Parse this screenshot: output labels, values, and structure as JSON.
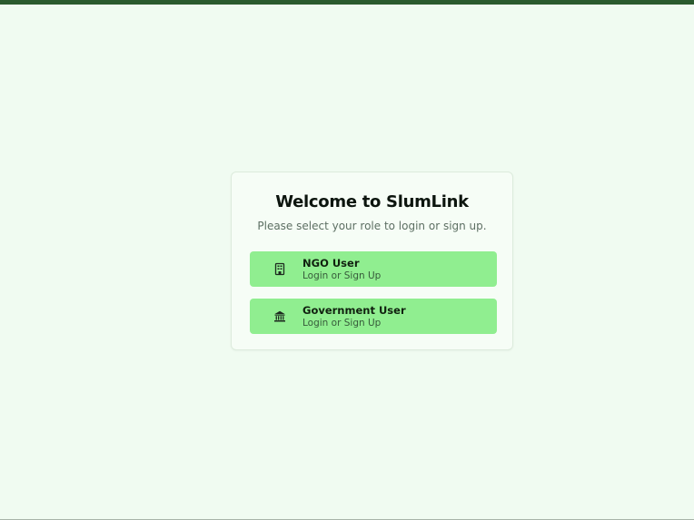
{
  "app": {
    "title": "Welcome to SlumLink",
    "subtitle": "Please select your role to login or sign up."
  },
  "roles": [
    {
      "name": "NGO User",
      "action": "Login or Sign Up",
      "icon": "building-icon"
    },
    {
      "name": "Government User",
      "action": "Login or Sign Up",
      "icon": "bank-icon"
    }
  ],
  "colors": {
    "top_bar": "#2b5a2e",
    "background": "#f0fbf1",
    "role_button": "#90ee90"
  }
}
